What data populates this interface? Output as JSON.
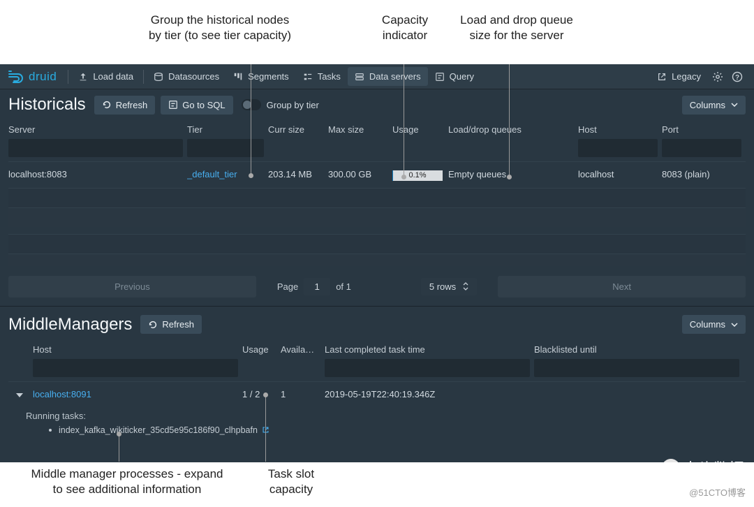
{
  "annotations": {
    "group_tier": "Group the historical nodes\nby tier (to see tier capacity)",
    "capacity": "Capacity\nindicator",
    "queues": "Load and drop queue\nsize for the server",
    "mm_expand": "Middle manager processes - expand\nto see additional information",
    "task_slot": "Task slot\ncapacity"
  },
  "brand": "druid",
  "nav": {
    "load_data": "Load data",
    "datasources": "Datasources",
    "segments": "Segments",
    "tasks": "Tasks",
    "data_servers": "Data servers",
    "query": "Query",
    "legacy": "Legacy"
  },
  "historicals": {
    "title": "Historicals",
    "refresh": "Refresh",
    "go_sql": "Go to SQL",
    "group_by_tier": "Group by tier",
    "columns_btn": "Columns",
    "headers": {
      "server": "Server",
      "tier": "Tier",
      "curr": "Curr size",
      "max": "Max size",
      "usage": "Usage",
      "queues": "Load/drop queues",
      "host": "Host",
      "port": "Port"
    },
    "row": {
      "server": "localhost:8083",
      "tier": "_default_tier",
      "curr": "203.14 MB",
      "max": "300.00 GB",
      "usage_pct": "0.1%",
      "queues": "Empty queues",
      "host": "localhost",
      "port": "8083 (plain)"
    },
    "pager": {
      "prev": "Previous",
      "next": "Next",
      "page_label": "Page",
      "page": "1",
      "of": "of 1",
      "rows": "5 rows"
    }
  },
  "mm": {
    "title": "MiddleManagers",
    "refresh": "Refresh",
    "columns_btn": "Columns",
    "headers": {
      "host": "Host",
      "usage": "Usage",
      "avail": "Availa…",
      "last": "Last completed task time",
      "blacklist": "Blacklisted until"
    },
    "row": {
      "host": "localhost:8091",
      "usage": "1 / 2",
      "avail": "1",
      "last": "2019-05-19T22:40:19.346Z",
      "blacklist": ""
    },
    "running_label": "Running tasks:",
    "task": "index_kafka_wikiticker_35cd5e95c186f90_clhpbafn"
  },
  "watermark": "大头数据",
  "credit": "@51CTO博客"
}
